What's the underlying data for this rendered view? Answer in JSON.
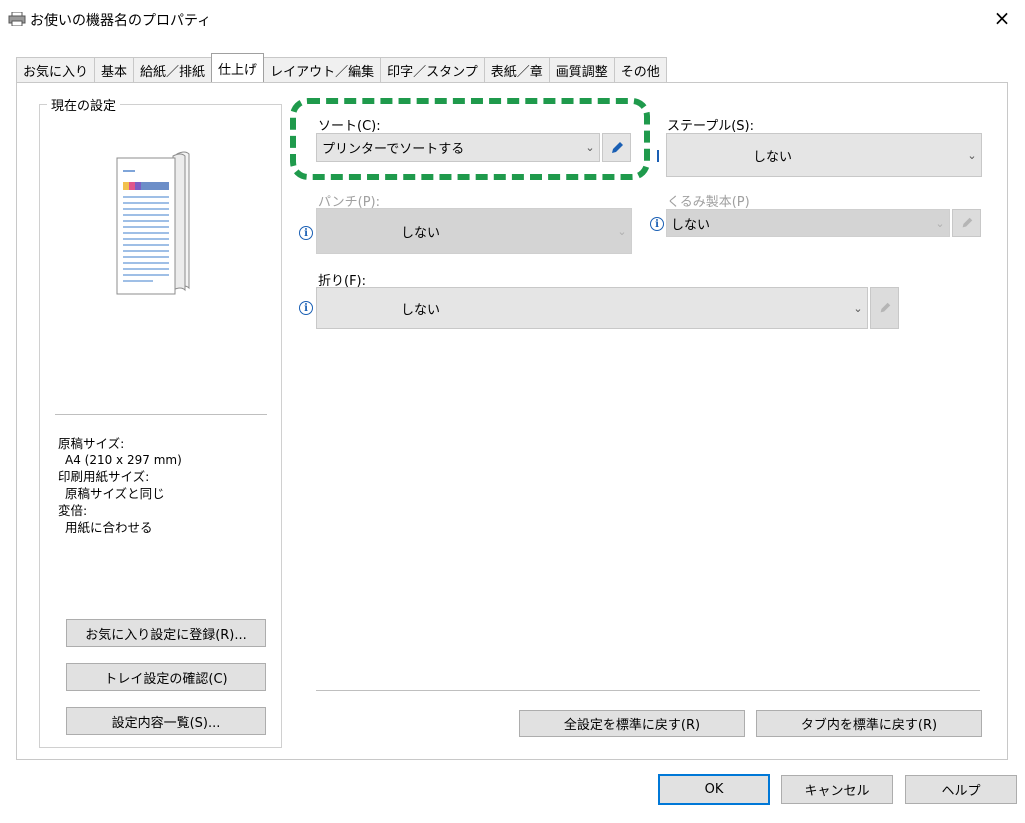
{
  "window": {
    "title": "お使いの機器名のプロパティ",
    "close_label": "×"
  },
  "tabs": [
    {
      "label": "お気に入り",
      "active": false
    },
    {
      "label": "基本",
      "active": false
    },
    {
      "label": "給紙／排紙",
      "active": false
    },
    {
      "label": "仕上げ",
      "active": true
    },
    {
      "label": "レイアウト／編集",
      "active": false
    },
    {
      "label": "印字／スタンプ",
      "active": false
    },
    {
      "label": "表紙／章",
      "active": false
    },
    {
      "label": "画質調整",
      "active": false
    },
    {
      "label": "その他",
      "active": false
    }
  ],
  "current_settings": {
    "group_label": "現在の設定",
    "info": {
      "original_size_label": "原稿サイズ:",
      "original_size_value": "A4 (210 x 297 mm)",
      "print_paper_label": "印刷用紙サイズ:",
      "print_paper_value": "原稿サイズと同じ",
      "scale_label": "変倍:",
      "scale_value": "用紙に合わせる"
    },
    "buttons": {
      "register_favorite": "お気に入り設定に登録(R)...",
      "tray_confirm": "トレイ設定の確認(C)",
      "settings_list": "設定内容一覧(S)..."
    }
  },
  "finishing": {
    "sort": {
      "label": "ソート(C):",
      "value": "プリンターでソートする"
    },
    "staple": {
      "label": "ステープル(S):",
      "value": "しない"
    },
    "punch": {
      "label": "パンチ(P):",
      "value": "しない"
    },
    "binding": {
      "label": "くるみ製本(P)",
      "value": "しない"
    },
    "fold": {
      "label": "折り(F):",
      "value": "しない"
    }
  },
  "footer_buttons": {
    "reset_all": "全設定を標準に戻す(R)",
    "reset_tab": "タブ内を標準に戻す(R)"
  },
  "dialog_buttons": {
    "ok": "OK",
    "cancel": "キャンセル",
    "help": "ヘルプ"
  },
  "colors": {
    "highlight": "#1f9a4c",
    "ok_border": "#0078d7",
    "info_icon": "#1a5fb4"
  }
}
